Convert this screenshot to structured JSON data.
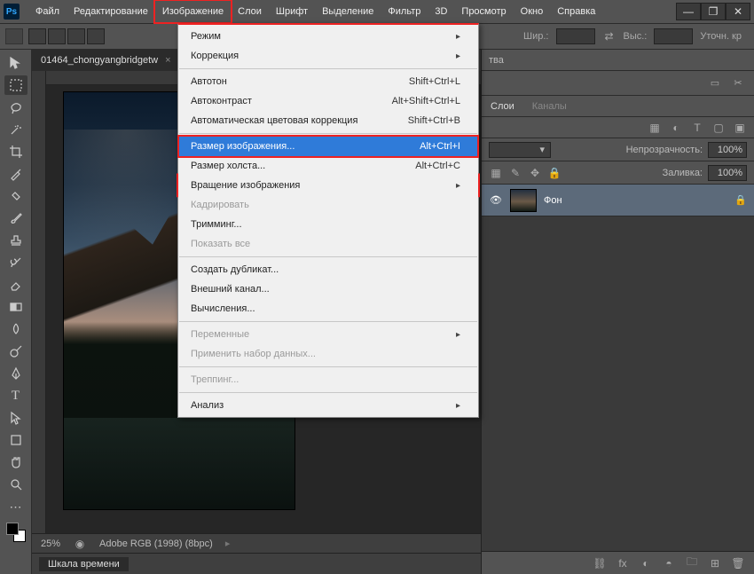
{
  "app": {
    "logo": "Ps"
  },
  "menu": {
    "items": [
      "Файл",
      "Редактирование",
      "Изображение",
      "Слои",
      "Шрифт",
      "Выделение",
      "Фильтр",
      "3D",
      "Просмотр",
      "Окно",
      "Справка"
    ],
    "active_index": 2
  },
  "window_controls": {
    "min": "—",
    "max": "❐",
    "close": "✕"
  },
  "options": {
    "width_label": "Шир.:",
    "height_label": "Выс.:",
    "refine_label": "Уточн. кр"
  },
  "dropdown": {
    "groups": [
      [
        {
          "label": "Режим",
          "sub": true
        },
        {
          "label": "Коррекция",
          "sub": true
        }
      ],
      [
        {
          "label": "Автотон",
          "shortcut": "Shift+Ctrl+L"
        },
        {
          "label": "Автоконтраст",
          "shortcut": "Alt+Shift+Ctrl+L"
        },
        {
          "label": "Автоматическая цветовая коррекция",
          "shortcut": "Shift+Ctrl+B"
        }
      ],
      [
        {
          "label": "Размер изображения...",
          "shortcut": "Alt+Ctrl+I",
          "highlight": true
        },
        {
          "label": "Размер холста...",
          "shortcut": "Alt+Ctrl+C"
        },
        {
          "label": "Вращение изображения",
          "sub": true
        },
        {
          "label": "Кадрировать",
          "disabled": true
        },
        {
          "label": "Тримминг..."
        },
        {
          "label": "Показать все",
          "disabled": true
        }
      ],
      [
        {
          "label": "Создать дубликат..."
        },
        {
          "label": "Внешний канал..."
        },
        {
          "label": "Вычисления..."
        }
      ],
      [
        {
          "label": "Переменные",
          "sub": true,
          "disabled": true
        },
        {
          "label": "Применить набор данных...",
          "disabled": true
        }
      ],
      [
        {
          "label": "Треппинг...",
          "disabled": true
        }
      ],
      [
        {
          "label": "Анализ",
          "sub": true
        }
      ]
    ]
  },
  "document": {
    "tab_name": "01464_chongyangbridgetw",
    "zoom": "25%",
    "profile": "Adobe RGB (1998) (8bpc)"
  },
  "right": {
    "header": "тва",
    "tabs": {
      "layers": "Слои",
      "channels": "Каналы"
    },
    "opacity_label": "Непрозрачность:",
    "opacity_value": "100%",
    "fill_label": "Заливка:",
    "fill_value": "100%",
    "lock_label": "",
    "layer_name": "Фон"
  },
  "timeline": {
    "tab": "Шкала времени"
  },
  "icons": {
    "search": "⌕",
    "triangle": "▾",
    "eye": "👁",
    "lock": "🔒",
    "link": "⛓",
    "fx": "fx",
    "mask": "◐",
    "folder": "🗀",
    "trash": "🗑",
    "new": "⊞",
    "filter": "⧉",
    "text": "T"
  }
}
